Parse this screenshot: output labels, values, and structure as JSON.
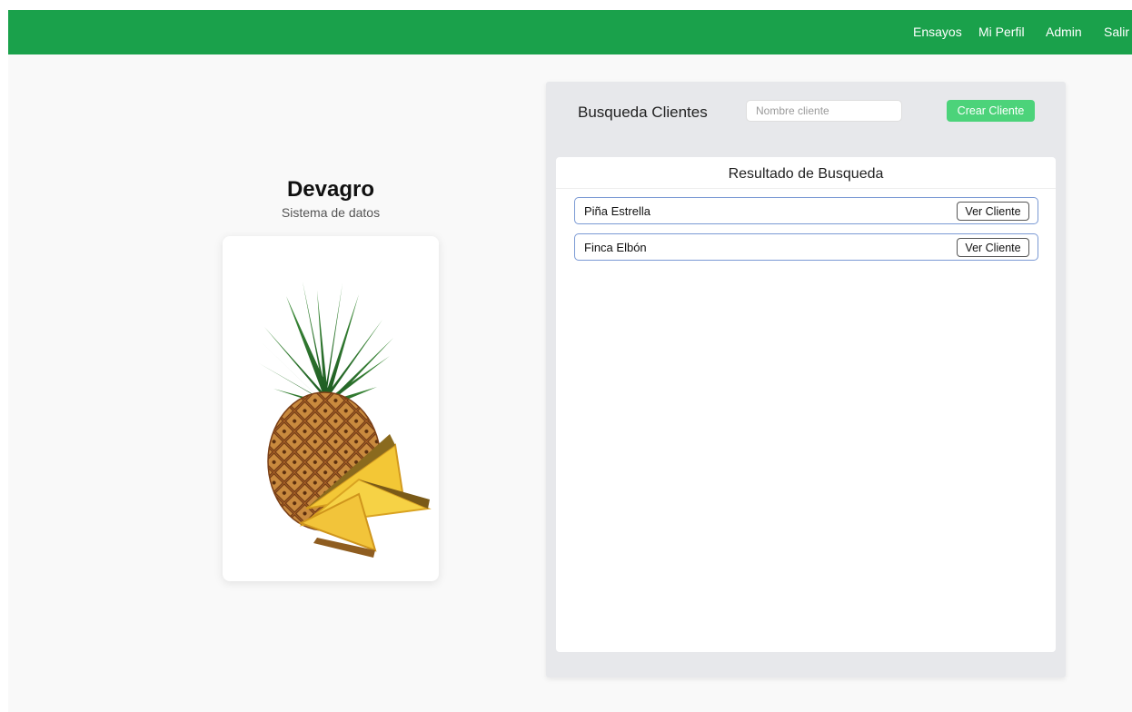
{
  "nav": {
    "items": [
      {
        "label": "Ensayos"
      },
      {
        "label": "Mi Perfil"
      },
      {
        "label": "Admin"
      },
      {
        "label": "Salir"
      }
    ]
  },
  "brand": {
    "title": "Devagro",
    "subtitle": "Sistema de datos"
  },
  "search": {
    "title": "Busqueda Clientes",
    "placeholder": "Nombre cliente",
    "value": "",
    "create_label": "Crear Cliente"
  },
  "results": {
    "title": "Resultado de Busqueda",
    "rows": [
      {
        "name": "Piña Estrella",
        "button_label": "Ver Cliente"
      },
      {
        "name": "Finca Elbón",
        "button_label": "Ver Cliente"
      }
    ]
  },
  "colors": {
    "nav_background": "#1aa14b",
    "create_button": "#4cd37a",
    "row_border": "#7a99d4"
  },
  "icons": {
    "illustration": "pineapple-image"
  }
}
